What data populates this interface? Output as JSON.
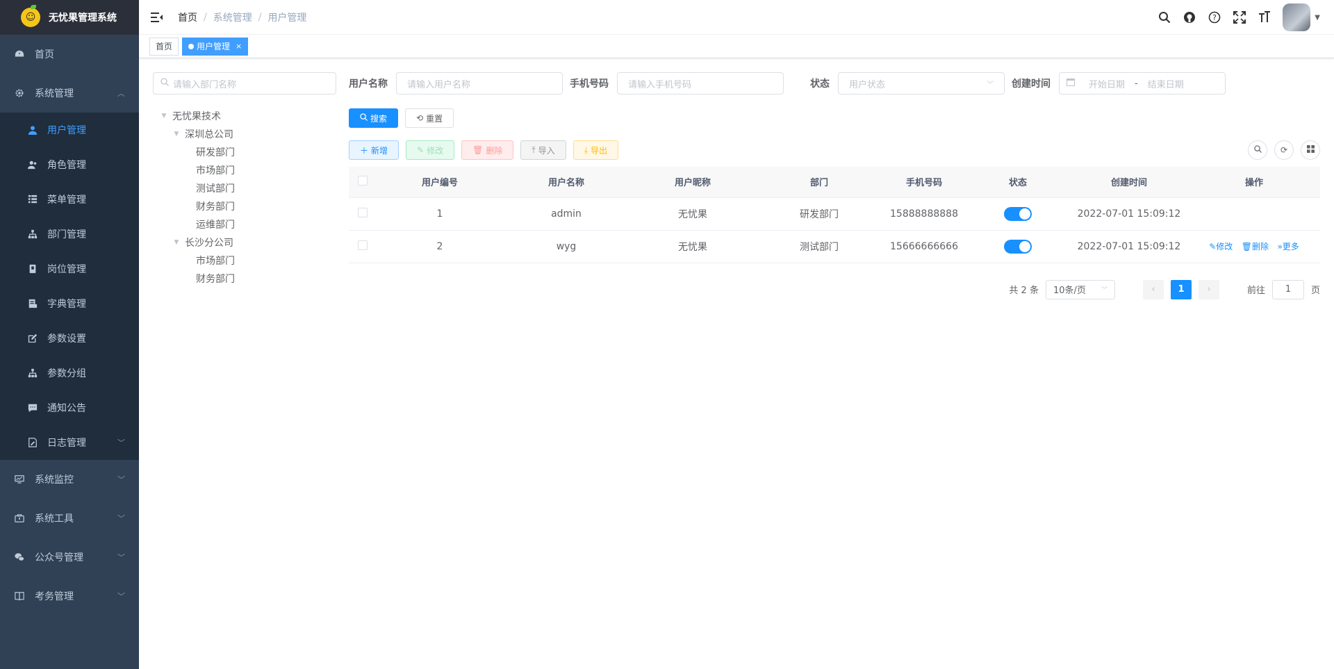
{
  "app": {
    "title": "无忧果管理系统"
  },
  "sidebar": {
    "home": "首页",
    "system": "系统管理",
    "system_items": [
      {
        "label": "用户管理",
        "icon": "user-icon"
      },
      {
        "label": "角色管理",
        "icon": "peoples-icon"
      },
      {
        "label": "菜单管理",
        "icon": "tree-table-icon"
      },
      {
        "label": "部门管理",
        "icon": "tree-icon"
      },
      {
        "label": "岗位管理",
        "icon": "post-icon"
      },
      {
        "label": "字典管理",
        "icon": "dict-icon"
      },
      {
        "label": "参数设置",
        "icon": "edit-icon"
      },
      {
        "label": "参数分组",
        "icon": "tree-icon"
      },
      {
        "label": "通知公告",
        "icon": "message-icon"
      },
      {
        "label": "日志管理",
        "icon": "log-icon"
      }
    ],
    "monitor": "系统监控",
    "tools": "系统工具",
    "wechat": "公众号管理",
    "attendance": "考务管理"
  },
  "header": {
    "breadcrumb": [
      "首页",
      "系统管理",
      "用户管理"
    ]
  },
  "tags": {
    "home": "首页",
    "current": "用户管理"
  },
  "dept_tree": {
    "search_placeholder": "请输入部门名称",
    "root": "无忧果技术",
    "branch1": "深圳总公司",
    "branch1_children": [
      "研发部门",
      "市场部门",
      "测试部门",
      "财务部门",
      "运维部门"
    ],
    "branch2": "长沙分公司",
    "branch2_children": [
      "市场部门",
      "财务部门"
    ]
  },
  "filters": {
    "username_label": "用户名称",
    "username_placeholder": "请输入用户名称",
    "phone_label": "手机号码",
    "phone_placeholder": "请输入手机号码",
    "status_label": "状态",
    "status_placeholder": "用户状态",
    "created_label": "创建时间",
    "start_placeholder": "开始日期",
    "range_sep": "-",
    "end_placeholder": "结束日期",
    "search_btn": "搜索",
    "reset_btn": "重置"
  },
  "toolbar": {
    "add": "新增",
    "edit": "修改",
    "delete": "删除",
    "import": "导入",
    "export": "导出"
  },
  "table": {
    "columns": [
      "用户编号",
      "用户名称",
      "用户昵称",
      "部门",
      "手机号码",
      "状态",
      "创建时间",
      "操作"
    ],
    "rows": [
      {
        "id": "1",
        "username": "admin",
        "nickname": "无忧果",
        "dept": "研发部门",
        "phone": "15888888888",
        "status": true,
        "created": "2022-07-01 15:09:12",
        "actions": []
      },
      {
        "id": "2",
        "username": "wyg",
        "nickname": "无忧果",
        "dept": "测试部门",
        "phone": "15666666666",
        "status": true,
        "created": "2022-07-01 15:09:12",
        "actions": [
          "修改",
          "删除",
          "更多"
        ]
      }
    ]
  },
  "pagination": {
    "total": "共 2 条",
    "page_size": "10条/页",
    "current": "1",
    "goto_label": "前往",
    "goto_value": "1",
    "page_unit": "页"
  },
  "colors": {
    "accent": "#1890ff",
    "sidebar": "#304156",
    "sidebar_active": "#409eff"
  }
}
